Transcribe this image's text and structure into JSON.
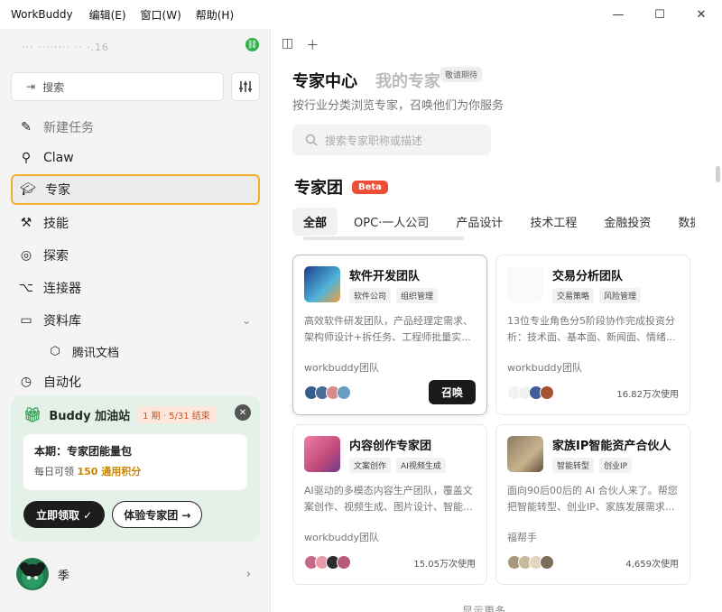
{
  "titlebar": {
    "app": "WorkBuddy",
    "menus": [
      "编辑(E)",
      "窗口(W)",
      "帮助(H)"
    ],
    "controls": [
      "—",
      "☐",
      "✕"
    ]
  },
  "sidebar": {
    "account": "··· ········ ·· ·.16",
    "search_placeholder": "搜索",
    "nav": [
      {
        "label": "新建任务"
      },
      {
        "label": "Claw"
      },
      {
        "label": "专家"
      },
      {
        "label": "技能"
      },
      {
        "label": "探索"
      },
      {
        "label": "连接器"
      },
      {
        "label": "资料库"
      },
      {
        "label": "腾讯文档"
      },
      {
        "label": "自动化"
      }
    ],
    "promo": {
      "title": "Buddy 加油站",
      "period": "1 期 · 5/31 结束",
      "box_title": "本期：专家团能量包",
      "box_line_prefix": "每日可领 ",
      "box_highlight": "150 通用积分",
      "claim": "立即领取 ✓",
      "try": "体验专家团 →"
    },
    "user_name": "季"
  },
  "main": {
    "tab_active": "专家中心",
    "tab_other": "我的专家",
    "badge": "敬请期待",
    "subtitle": "按行业分类浏览专家，召唤他们为你服务",
    "search_placeholder": "搜索专家职称或描述",
    "group_title": "专家团",
    "beta": "Beta",
    "categories": [
      "全部",
      "OPC·一人公司",
      "产品设计",
      "技术工程",
      "金融投资",
      "数据"
    ],
    "cards": [
      {
        "name": "软件开发团队",
        "tags": [
          "软件公司",
          "组织管理"
        ],
        "desc": "高效软件研发团队，产品经理定需求、架构师设计+拆任务、工程师批量实...",
        "author": "workbuddy团队",
        "action": "召唤"
      },
      {
        "name": "交易分析团队",
        "tags": [
          "交易策略",
          "风险管理"
        ],
        "desc": "13位专业角色分5阶段协作完成投资分析：技术面、基本面、新闻面、情绪...",
        "author": "workbuddy团队",
        "uses": "16.82万次使用"
      },
      {
        "name": "内容创作专家团",
        "tags": [
          "文案创作",
          "AI视频生成"
        ],
        "desc": "AI驱动的多模态内容生产团队，覆盖文案创作、视频生成、图片设计、智能...",
        "author": "workbuddy团队",
        "uses": "15.05万次使用"
      },
      {
        "name": "家族IP智能资产合伙人",
        "tags": [
          "智能转型",
          "创业IP"
        ],
        "desc": "面向90后00后的 AI 合伙人来了。帮您把智能转型、创业IP、家族发展需求...",
        "author": "福帮手",
        "uses": "4,659次使用"
      }
    ],
    "show_more": "显示更多 ⌄"
  },
  "colors": {
    "accent_border": "#f0b02a",
    "beta": "#ef4e36",
    "promo_bg": "#e3f1e8",
    "highlight": "#c98400"
  }
}
